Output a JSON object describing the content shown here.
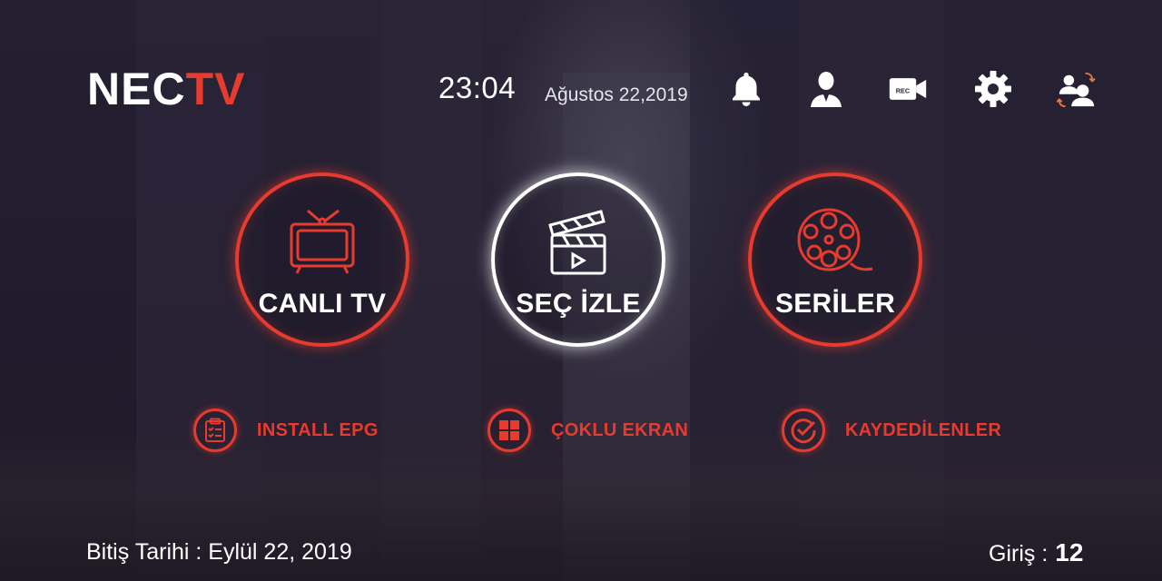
{
  "brand": {
    "logo_white": "NEC",
    "logo_red": "TV",
    "accent": "#e63b2e"
  },
  "header": {
    "time": "23:04",
    "date": "Ağustos 22,2019",
    "icons": [
      "bell-icon",
      "user-icon",
      "record-camera-icon",
      "gear-icon",
      "switch-user-icon"
    ],
    "rec_label": "REC"
  },
  "main": {
    "tiles": [
      {
        "label": "CANLI TV",
        "icon": "tv-icon",
        "selected": false
      },
      {
        "label": "SEÇ İZLE",
        "icon": "clapperboard-icon",
        "selected": true
      },
      {
        "label": "SERİLER",
        "icon": "film-reel-icon",
        "selected": false
      }
    ]
  },
  "secondary": [
    {
      "label": "INSTALL EPG",
      "icon": "checklist-icon"
    },
    {
      "label": "ÇOKLU EKRAN",
      "icon": "grid-icon"
    },
    {
      "label": "KAYDEDİLENLER",
      "icon": "check-circle-icon"
    }
  ],
  "footer": {
    "expiry": "Bitiş Tarihi : Eylül 22, 2019",
    "login_label": "Giriş :",
    "login_count": "12"
  }
}
